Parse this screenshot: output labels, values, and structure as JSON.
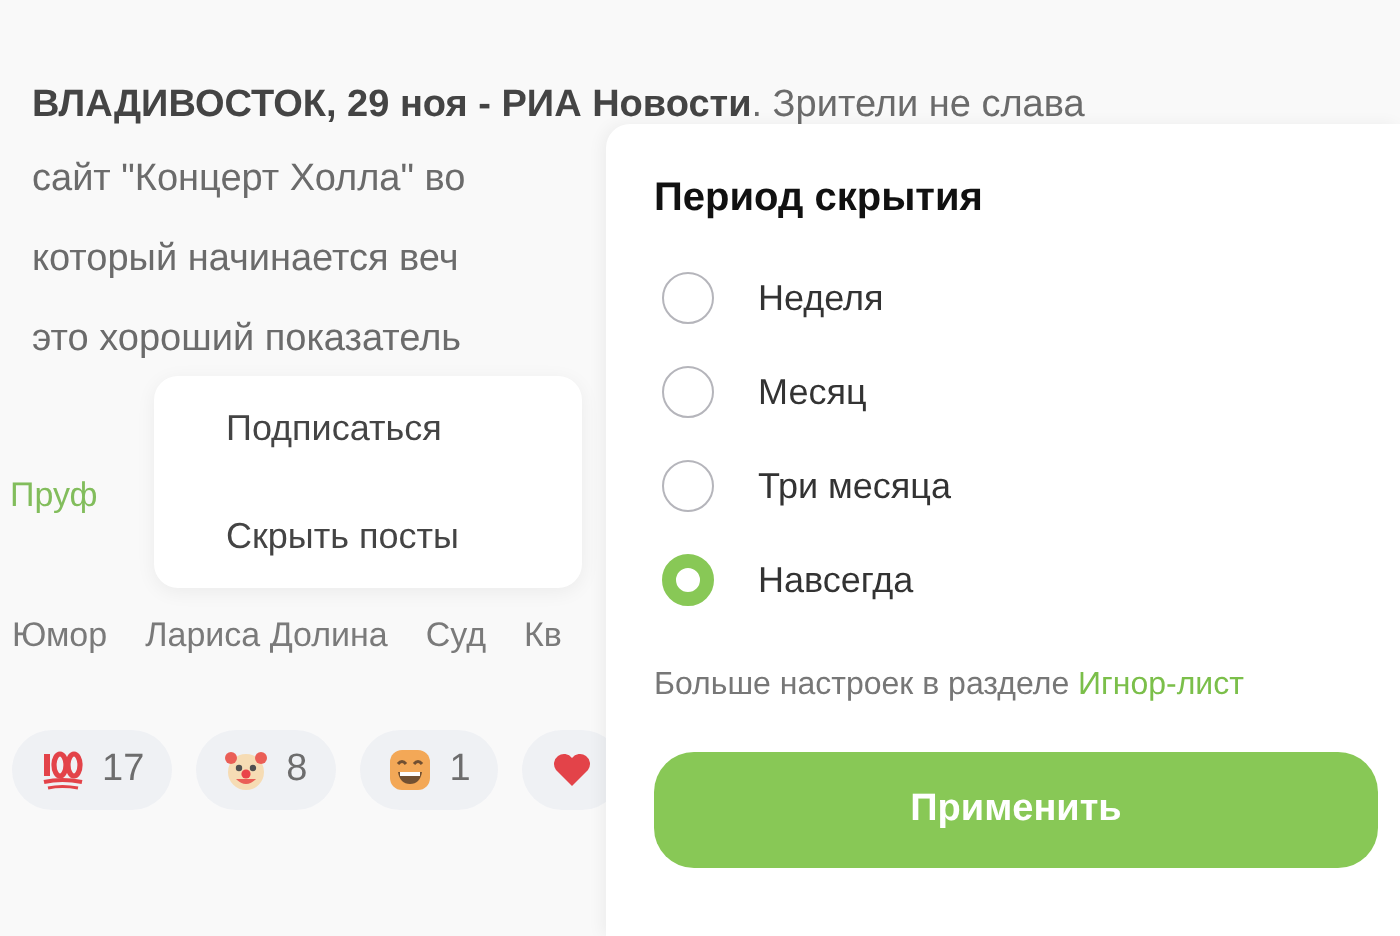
{
  "article": {
    "lines": [
      "**ВЛАДИВОСТОК, 29 ноя - РИА Новости**. Зрители не слава",
      "сайт \"Концерт Холла\" во",
      "который начинается веч",
      "это хороший показатель"
    ],
    "source_link": "Пруф"
  },
  "context_menu": {
    "items": [
      "Подписаться",
      "Скрыть посты"
    ]
  },
  "tags": [
    "Юмор",
    "Лариса Долина",
    "Суд",
    "Кв"
  ],
  "reactions": [
    {
      "kind": "hundred",
      "count": "17"
    },
    {
      "kind": "clown",
      "count": "8"
    },
    {
      "kind": "grin",
      "count": "1"
    },
    {
      "kind": "heart"
    }
  ],
  "hide_dialog": {
    "title": "Период скрытия",
    "options": [
      {
        "label": "Неделя",
        "selected": false
      },
      {
        "label": "Месяц",
        "selected": false
      },
      {
        "label": "Три месяца",
        "selected": false
      },
      {
        "label": "Навсегда",
        "selected": true
      }
    ],
    "footer_text": "Больше настроек в разделе",
    "footer_link": "Игнор-лист",
    "apply_button": "Применить"
  }
}
